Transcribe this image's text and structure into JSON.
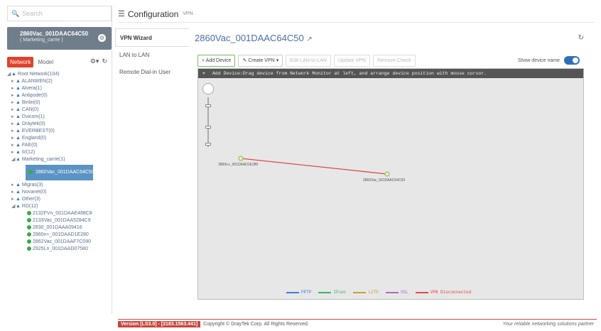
{
  "search": {
    "icon": "search-icon",
    "placeholder": "Search"
  },
  "device_card": {
    "name": "2860Vac_001DAAC64C50",
    "group": "( Marketing_carrie )"
  },
  "network_tabs": {
    "network": "Network",
    "model": "Model"
  },
  "tree": {
    "root": "Root Network(104)",
    "groups_top": [
      "ALANWEN(2)",
      "Alvera(1)",
      "Antipode(0)",
      "Binlei(0)",
      "CAN(0)",
      "Dvicom(1)",
      "Draytek(0)",
      "EVERBEST(0)",
      "England(0)",
      "FAE(0)",
      "II/(12)"
    ],
    "marketing": "Marketing_carrie(1)",
    "selected_device": "2860Vac_001DAAC64C50",
    "groups_mid": [
      "Migras(3)",
      "Novanet(0)",
      "Other(3)"
    ],
    "rd": "RD(12)",
    "rd_devices": [
      "2132FVn_001DAAE488C8",
      "2133Vac_001DAA5284C9",
      "2830_001DAAA09416",
      "2860n+_001DAAD1E280",
      "2862Vac_001DAAF7C090",
      "2925Ln_001DAAD07580"
    ]
  },
  "header": {
    "title": "Configuration",
    "subtitle": "VPN"
  },
  "subnav": [
    "VPN Wizard",
    "LAN to LAN",
    "Remote Dial-in User"
  ],
  "main": {
    "title": "2860Vac_001DAAC64C50",
    "toolbar": {
      "add_device": "+ Add Device",
      "create_vpn": "Create VPN",
      "edit_lan2lan": "Edit LAN-to-LAN",
      "update_vpn": "Update VPN",
      "remove_check": "Remove Check"
    },
    "show_device_name": "Show device name",
    "show_device_name_on": true,
    "hint": "Add Device:Drag device from Network Monitor at left, and arrange device position with mouse cursor.",
    "nodes": [
      "2860n+_001DAAD1E280",
      "2860Vac_001DAAC64C50"
    ],
    "legend": [
      {
        "label": "PPTP",
        "color": "#3b7fd9"
      },
      {
        "label": "IPsec",
        "color": "#3bb36b"
      },
      {
        "label": "L2TP",
        "color": "#c9a040"
      },
      {
        "label": "SSL",
        "color": "#b069b8"
      },
      {
        "label": "VPN Disconnected",
        "color": "#e04848"
      }
    ]
  },
  "footer": {
    "version": "Version [LS3.0] - [2183.1563.441]",
    "copyright": "Copyright © DrayTek Corp. All Rights Reserved.",
    "tagline": "Your reliable networking solutions partner"
  },
  "colors": {
    "accent": "#e0412b",
    "selected": "#5b93c4",
    "link": "#4a6ea8"
  }
}
